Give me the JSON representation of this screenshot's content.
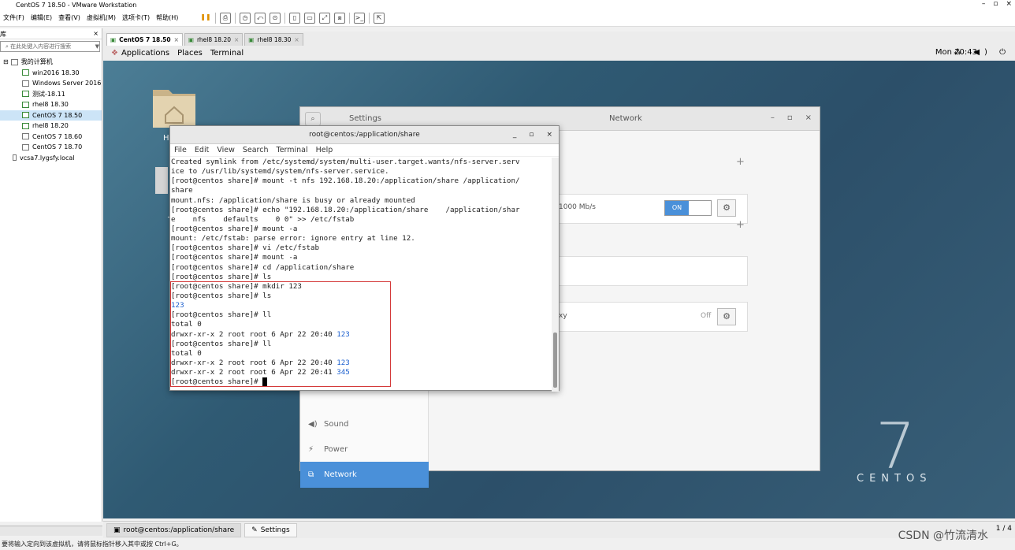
{
  "window": {
    "title": "CentOS 7  18.50 - VMware Workstation",
    "controls": [
      "–",
      "▫",
      "×"
    ]
  },
  "menu": [
    "文件(F)",
    "编辑(E)",
    "查看(V)",
    "虚拟机(M)",
    "选项卡(T)",
    "帮助(H)"
  ],
  "library": {
    "title": "库",
    "close": "×",
    "search_placeholder": "在此处键入内容进行搜索",
    "root": "我的计算机",
    "items": [
      {
        "label": "win2016 18.30",
        "running": true
      },
      {
        "label": "Windows Server 2016",
        "running": false
      },
      {
        "label": "测试-18.11",
        "running": true
      },
      {
        "label": "rhel8 18.30",
        "running": true
      },
      {
        "label": "CentOS 7  18.50",
        "running": true,
        "selected": true
      },
      {
        "label": "rhel8 18.20",
        "running": true
      },
      {
        "label": "CentOS 7 18.60",
        "running": false
      },
      {
        "label": "CentOS 7 18.70",
        "running": false
      }
    ],
    "remote": "vcsa7.lygsfy.local"
  },
  "tabs": [
    {
      "label": "CentOS 7  18.50",
      "active": true
    },
    {
      "label": "rhel8 18.20",
      "active": false
    },
    {
      "label": "rhel8 18.30",
      "active": false
    }
  ],
  "guest": {
    "topbar": {
      "applications": "Applications",
      "places": "Places",
      "terminal": "Terminal",
      "clock": "Mon 20:43",
      "tray": "⁂ ◀) ⏻"
    },
    "desktop": {
      "home_label": "H",
      "trash_label": "T",
      "logo_number": "7",
      "logo_text": "CENTOS"
    },
    "settings": {
      "left_title": "Settings",
      "right_title": "Network",
      "speed": "1000 Mb/s",
      "switch_on": "ON",
      "proxy_label": "xy",
      "proxy_state": "Off",
      "sidebar": [
        {
          "label": "Sound",
          "icon": "◀)"
        },
        {
          "label": "Power",
          "icon": "⚡"
        },
        {
          "label": "Network",
          "icon": "⧉",
          "active": true
        }
      ]
    },
    "terminal": {
      "title": "root@centos:/application/share",
      "menu": [
        "File",
        "Edit",
        "View",
        "Search",
        "Terminal",
        "Help"
      ],
      "lines": [
        [
          "Created symlink from /etc/systemd/system/multi-user.target.wants/nfs-server.serv",
          ""
        ],
        [
          "ice to /usr/lib/systemd/system/nfs-server.service.",
          ""
        ],
        [
          "[root@centos share]# mount -t nfs 192.168.18.20:/application/share /application/",
          ""
        ],
        [
          "share",
          ""
        ],
        [
          "mount.nfs: /application/share is busy or already mounted",
          ""
        ],
        [
          "[root@centos share]# echo \"192.168.18.20:/application/share    /application/shar",
          ""
        ],
        [
          "e    nfs    defaults    0 0\" >> /etc/fstab",
          ""
        ],
        [
          "[root@centos share]# mount -a",
          ""
        ],
        [
          "mount: /etc/fstab: parse error: ignore entry at line 12.",
          ""
        ],
        [
          "[root@centos share]# vi /etc/fstab",
          ""
        ],
        [
          "[root@centos share]# mount -a",
          ""
        ],
        [
          "[root@centos share]# cd /application/share",
          ""
        ],
        [
          "[root@centos share]# ls",
          ""
        ],
        [
          "[root@centos share]# mkdir 123",
          ""
        ],
        [
          "[root@centos share]# ls",
          ""
        ],
        [
          "",
          "123"
        ],
        [
          "[root@centos share]# ll",
          ""
        ],
        [
          "total 0",
          ""
        ],
        [
          "drwxr-xr-x 2 root root 6 Apr 22 20:40 ",
          "123"
        ],
        [
          "[root@centos share]# ll",
          ""
        ],
        [
          "total 0",
          ""
        ],
        [
          "drwxr-xr-x 2 root root 6 Apr 22 20:40 ",
          "123"
        ],
        [
          "drwxr-xr-x 2 root root 6 Apr 22 20:41 ",
          "345"
        ],
        [
          "[root@centos share]# ",
          ""
        ]
      ]
    }
  },
  "taskbar": {
    "items": [
      {
        "label": "root@centos:/application/share"
      },
      {
        "label": "Settings"
      }
    ],
    "pager": "1 / 4"
  },
  "status": "要将输入定向到该虚拟机，请将鼠标指针移入其中或按 Ctrl+G。",
  "watermark": "CSDN @竹流清水"
}
